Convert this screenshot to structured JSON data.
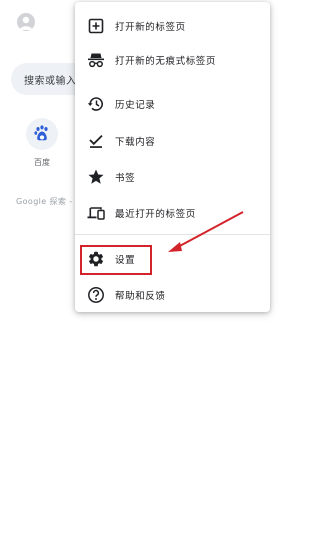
{
  "home": {
    "search_placeholder": "搜索或输入网",
    "shortcut_label": "百度",
    "google_hint": "Google 探索 - E"
  },
  "menu": {
    "items": [
      {
        "label": "打开新的标签页",
        "icon": "plus-box-icon"
      },
      {
        "label": "打开新的无痕式标签页",
        "icon": "incognito-icon"
      },
      {
        "label": "历史记录",
        "icon": "history-icon"
      },
      {
        "label": "下载内容",
        "icon": "download-icon"
      },
      {
        "label": "书签",
        "icon": "star-icon"
      },
      {
        "label": "最近打开的标签页",
        "icon": "devices-icon"
      },
      {
        "label": "设置",
        "icon": "gear-icon"
      },
      {
        "label": "帮助和反馈",
        "icon": "help-icon"
      }
    ]
  },
  "annotation": {
    "color": "#d3242b"
  }
}
